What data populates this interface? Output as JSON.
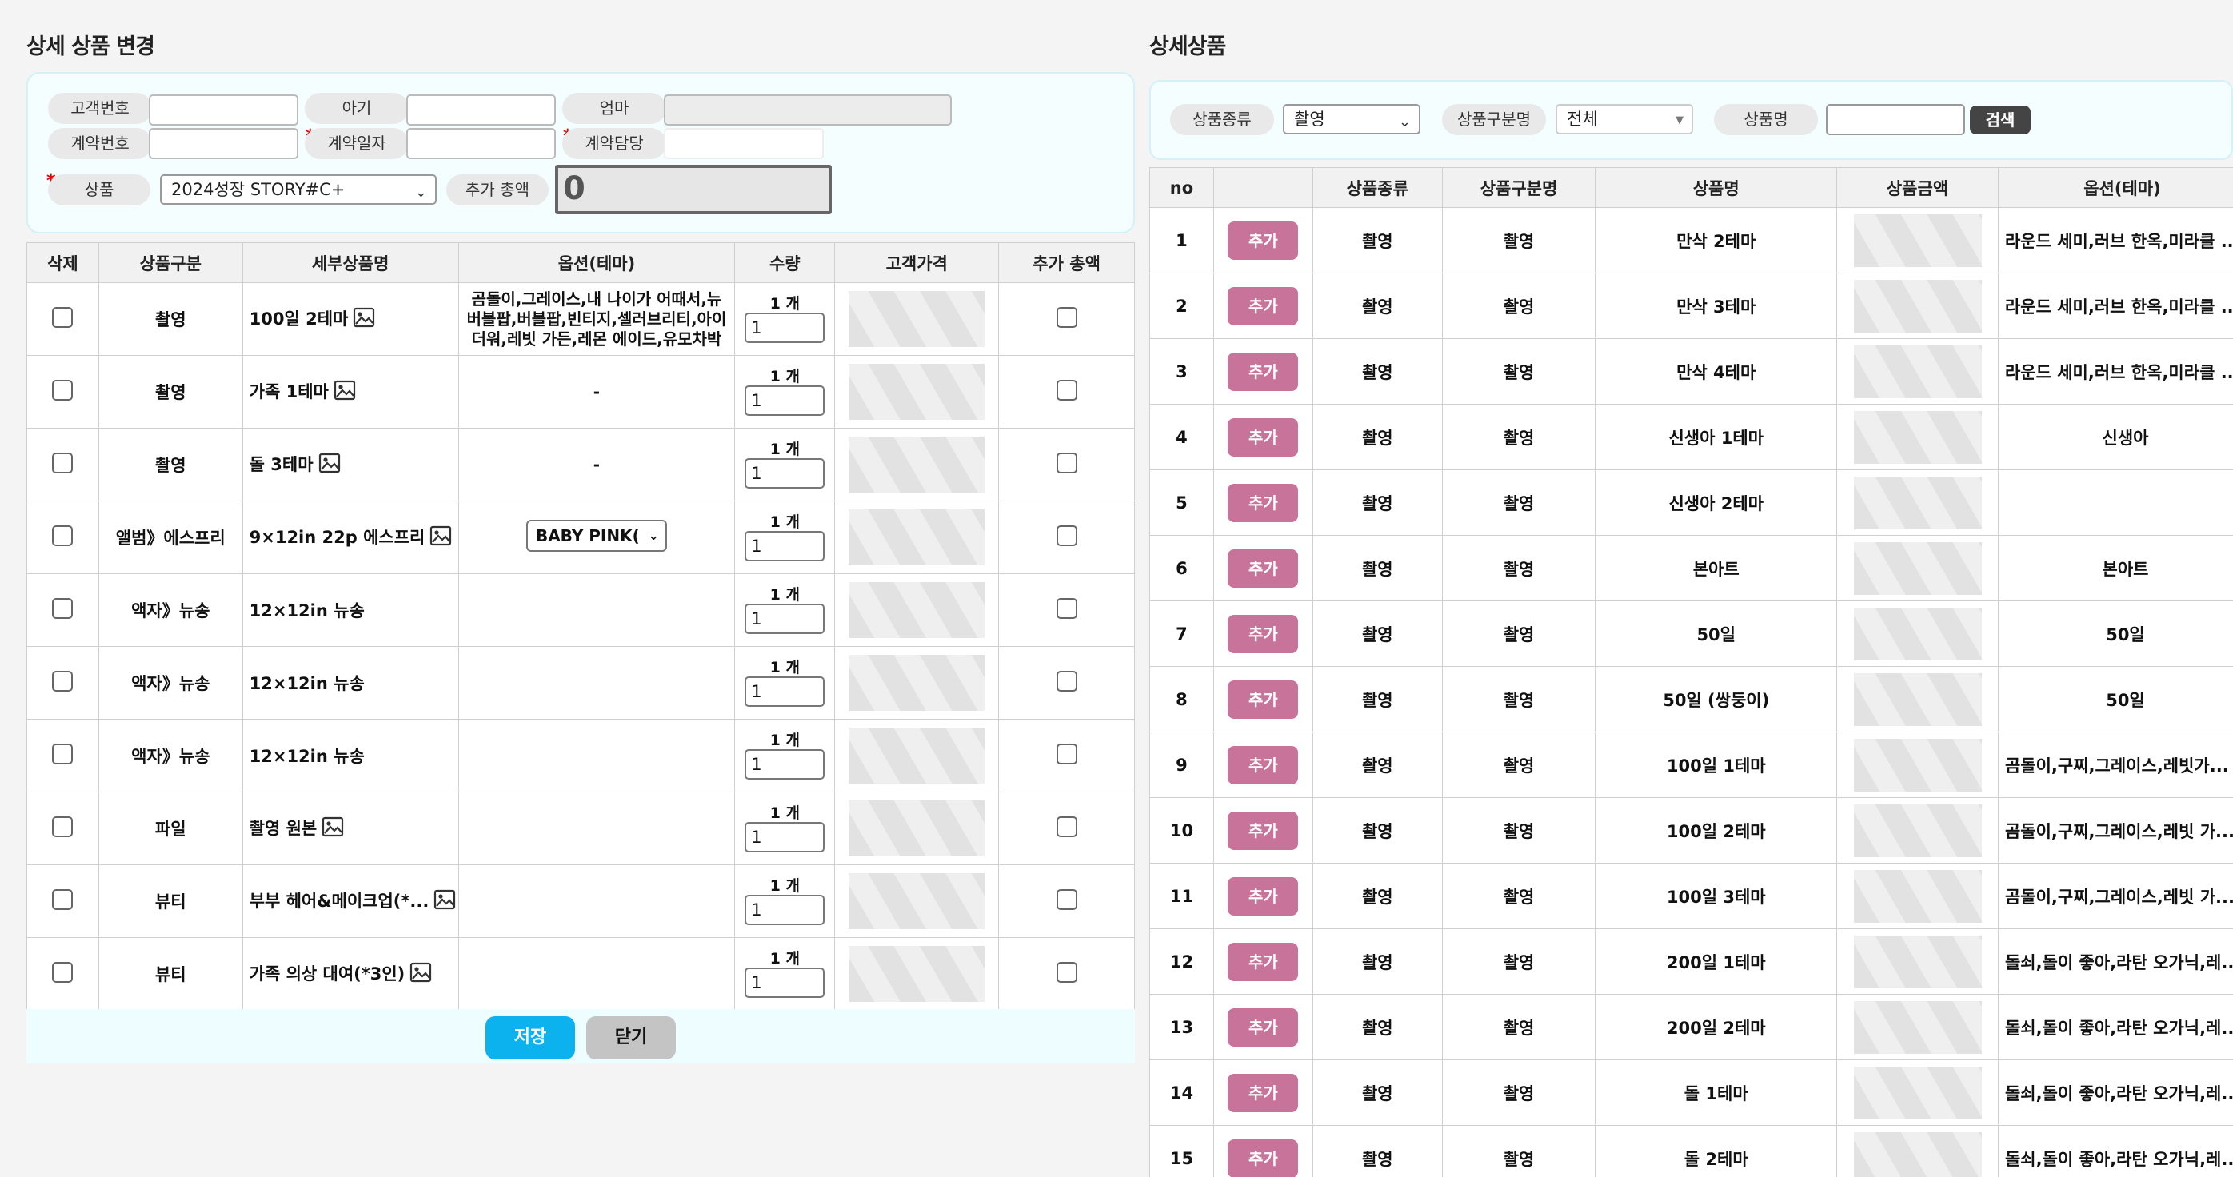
{
  "left": {
    "title": "상세 상품 변경",
    "labels": {
      "customer_no": "고객번호",
      "baby": "아기",
      "mom": "엄마",
      "contract_no": "계약번호",
      "contract_date": "계약일자",
      "contract_manager": "계약담당",
      "product": "상품",
      "extra_total": "추가 총액"
    },
    "required_mark": "*",
    "product_select": "2024성장 STORY#C+",
    "extra_total_value": "0",
    "columns": [
      "삭제",
      "상품구분",
      "세부상품명",
      "옵션(테마)",
      "수량",
      "고객가격",
      "추가 총액"
    ],
    "rows": [
      {
        "category": "촬영",
        "name": "100일 2테마",
        "has_image": true,
        "option": "곰돌이,그레이스,내 나이가 어때서,뉴버블팝,버블팝,빈티지,셀러브리티,아이더워,레빗 가든,레몬 에이드,유모차박",
        "qty_label": "1 개",
        "qty": "1"
      },
      {
        "category": "촬영",
        "name": "가족 1테마",
        "has_image": true,
        "option": "-",
        "qty_label": "1 개",
        "qty": "1"
      },
      {
        "category": "촬영",
        "name": "돌 3테마",
        "has_image": true,
        "option": "-",
        "qty_label": "1 개",
        "qty": "1"
      },
      {
        "category": "앨범》에스프리",
        "name": "9×12in 22p 에스프리",
        "has_image": true,
        "option_select": "BABY PINK(",
        "qty_label": "1 개",
        "qty": "1"
      },
      {
        "category": "액자》뉴송",
        "name": "12×12in 뉴송",
        "has_image": false,
        "option": "",
        "qty_label": "1 개",
        "qty": "1"
      },
      {
        "category": "액자》뉴송",
        "name": "12×12in 뉴송",
        "has_image": false,
        "option": "",
        "qty_label": "1 개",
        "qty": "1"
      },
      {
        "category": "액자》뉴송",
        "name": "12×12in 뉴송",
        "has_image": false,
        "option": "",
        "qty_label": "1 개",
        "qty": "1"
      },
      {
        "category": "파일",
        "name": "촬영 원본",
        "has_image": true,
        "option": "",
        "qty_label": "1 개",
        "qty": "1"
      },
      {
        "category": "뷰티",
        "name": "부부 헤어&메이크업(*...",
        "has_image": true,
        "option": "",
        "qty_label": "1 개",
        "qty": "1"
      },
      {
        "category": "뷰티",
        "name": "가족 의상 대여(*3인)",
        "has_image": true,
        "option": "",
        "qty_label": "1 개",
        "qty": "1"
      }
    ],
    "save_label": "저장",
    "close_label": "닫기"
  },
  "right": {
    "title": "상세상품",
    "filters": {
      "type_label": "상품종류",
      "type_value": "촬영",
      "group_label": "상품구분명",
      "group_value": "전체",
      "name_label": "상품명",
      "name_value": "",
      "search_label": "검색"
    },
    "columns": [
      "no",
      "",
      "상품종류",
      "상품구분명",
      "상품명",
      "상품금액",
      "옵션(테마)"
    ],
    "add_label": "추가",
    "rows": [
      {
        "no": "1",
        "type": "촬영",
        "group": "촬영",
        "name": "만삭 2테마",
        "option": "라운드 세미,러브 한옥,미라클 ..."
      },
      {
        "no": "2",
        "type": "촬영",
        "group": "촬영",
        "name": "만삭 3테마",
        "option": "라운드 세미,러브 한옥,미라클 ..."
      },
      {
        "no": "3",
        "type": "촬영",
        "group": "촬영",
        "name": "만삭 4테마",
        "option": "라운드 세미,러브 한옥,미라클 ..."
      },
      {
        "no": "4",
        "type": "촬영",
        "group": "촬영",
        "name": "신생아 1테마",
        "option": "신생아",
        "center": true
      },
      {
        "no": "5",
        "type": "촬영",
        "group": "촬영",
        "name": "신생아 2테마",
        "option": ""
      },
      {
        "no": "6",
        "type": "촬영",
        "group": "촬영",
        "name": "본아트",
        "option": "본아트",
        "center": true
      },
      {
        "no": "7",
        "type": "촬영",
        "group": "촬영",
        "name": "50일",
        "option": "50일",
        "center": true
      },
      {
        "no": "8",
        "type": "촬영",
        "group": "촬영",
        "name": "50일 (쌍둥이)",
        "option": "50일",
        "center": true
      },
      {
        "no": "9",
        "type": "촬영",
        "group": "촬영",
        "name": "100일 1테마",
        "option": "곰돌이,구찌,그레이스,레빗가..."
      },
      {
        "no": "10",
        "type": "촬영",
        "group": "촬영",
        "name": "100일 2테마",
        "option": "곰돌이,구찌,그레이스,레빗 가..."
      },
      {
        "no": "11",
        "type": "촬영",
        "group": "촬영",
        "name": "100일 3테마",
        "option": "곰돌이,구찌,그레이스,레빗 가..."
      },
      {
        "no": "12",
        "type": "촬영",
        "group": "촬영",
        "name": "200일 1테마",
        "option": "돌쇠,돌이 좋아,라탄 오가닉,레..."
      },
      {
        "no": "13",
        "type": "촬영",
        "group": "촬영",
        "name": "200일 2테마",
        "option": "돌쇠,돌이 좋아,라탄 오가닉,레..."
      },
      {
        "no": "14",
        "type": "촬영",
        "group": "촬영",
        "name": "돌 1테마",
        "option": "돌쇠,돌이 좋아,라탄 오가닉,레..."
      },
      {
        "no": "15",
        "type": "촬영",
        "group": "촬영",
        "name": "돌 2테마",
        "option": "돌쇠,돌이 좋아,라탄 오가닉,레..."
      }
    ]
  }
}
